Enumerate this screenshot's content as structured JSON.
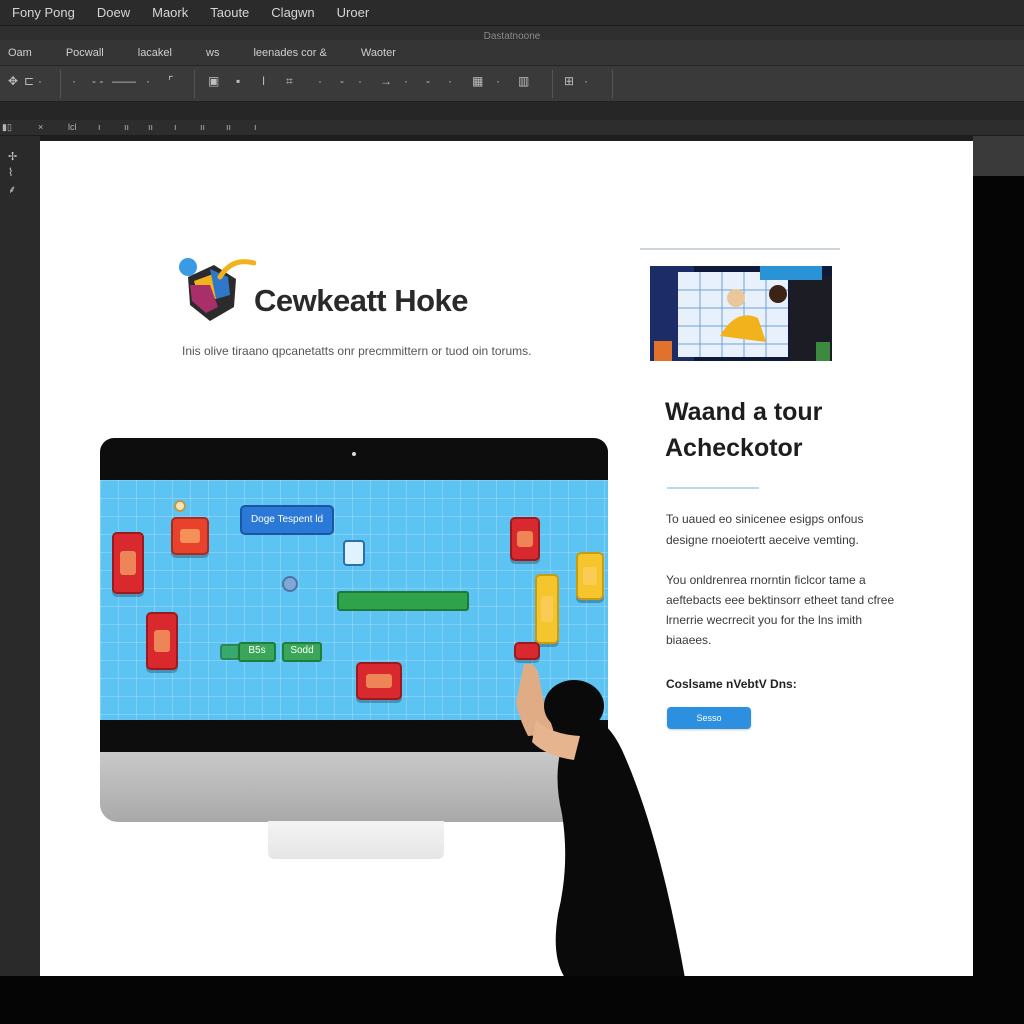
{
  "menu": [
    "Fony Pong",
    "Doew",
    "Maork",
    "Taoute",
    "Clagwn",
    "Uroer"
  ],
  "window_title": "Dastatnoone",
  "options": [
    "Oam",
    "Pocwall",
    "lacakel",
    "ws",
    "leenades cor &",
    "Waoter"
  ],
  "doc_tab": "lcl",
  "page": {
    "brand": "Cewkeatt Hoke",
    "tagline": "Inis olive tiraano qpcanetatts onr precmmittern or tuod oin torums.",
    "headline_line1": "Waand a tour",
    "headline_line2": "Acheckotor",
    "para1": "To uaued eo sinicenee esigps onfous designe rnoeiotertt aeceive vemting.",
    "para2": "You onldrenrea rnorntin ficlcor tame a aeftebacts eee bektinsorr etheet tand cfree lrnerrie wecrrecit you for the lns imith biaaees.",
    "cta_label": "Coslsame nVebtV Dns:",
    "cta_button": "Sesso"
  },
  "game_screen": {
    "label_pill": "Doge Tespent ld",
    "chip1": "B5s",
    "chip2": "Sodd"
  },
  "colors": {
    "screen_blue": "#5cc3f3",
    "cta_blue": "#2c8fe0",
    "block_red": "#d8292f",
    "block_yellow": "#f4c52c",
    "bar_green": "#2ea34b"
  }
}
